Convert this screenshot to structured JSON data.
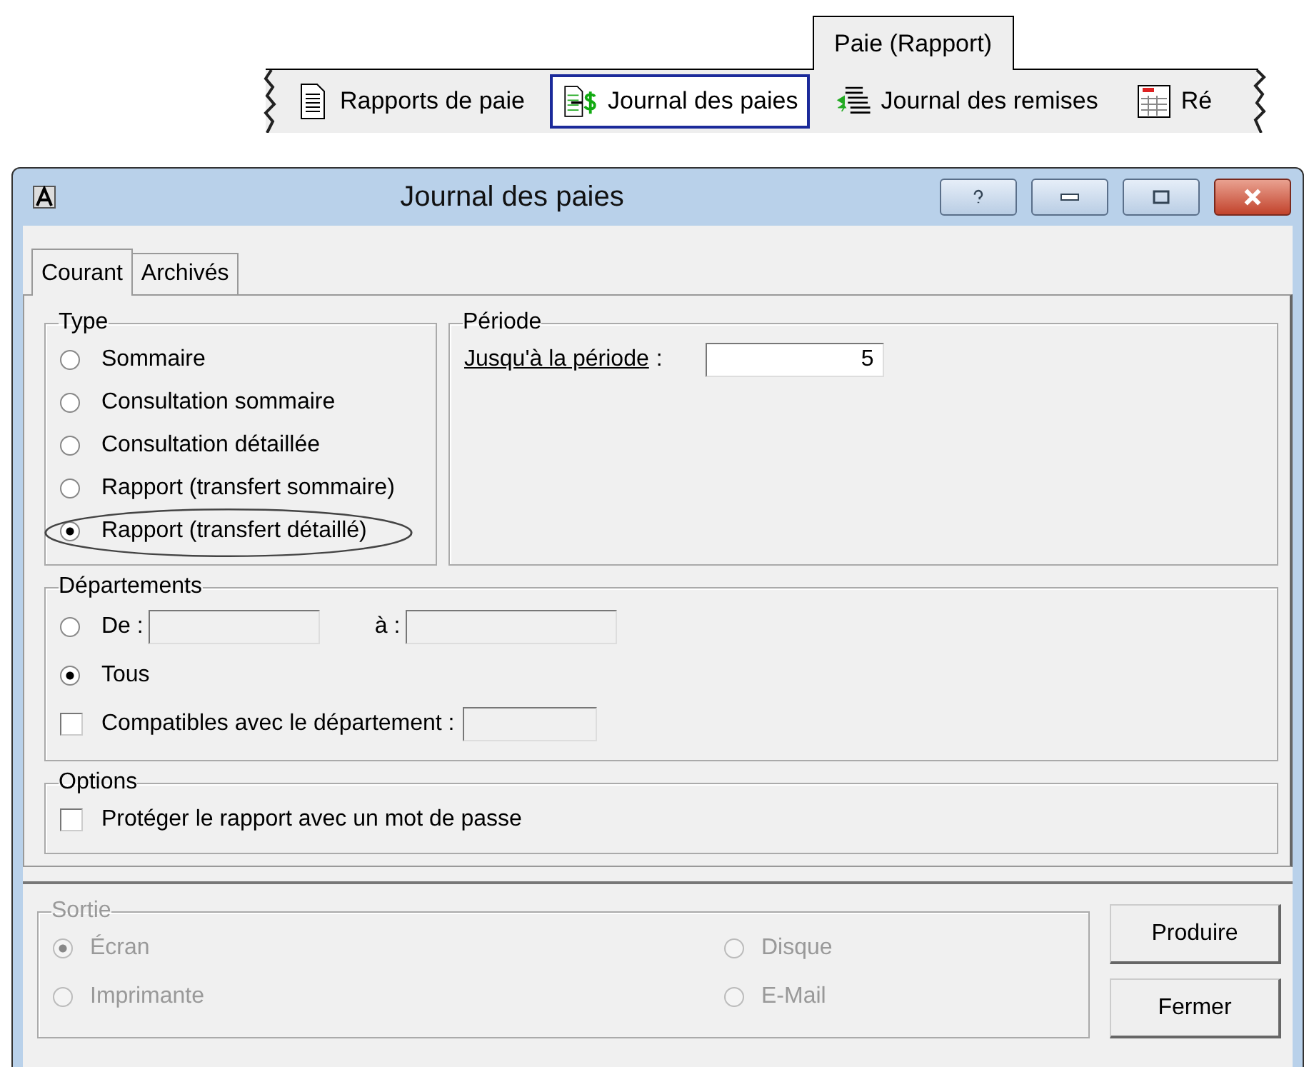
{
  "ribbon": {
    "tab": "Paie (Rapport)",
    "items": [
      {
        "kind": "report",
        "label": "Rapports de paie",
        "selected": false
      },
      {
        "kind": "payroll",
        "label": "Journal des paies",
        "selected": true
      },
      {
        "kind": "remittance",
        "label": "Journal des remises",
        "selected": false
      },
      {
        "kind": "calendar",
        "label": "Ré",
        "selected": false
      }
    ]
  },
  "dialog": {
    "title": "Journal des paies",
    "tabs": [
      {
        "label": "Courant",
        "selected": true
      },
      {
        "label": "Archivés",
        "selected": false
      }
    ],
    "type": {
      "title": "Type",
      "options": [
        {
          "label": "Sommaire",
          "selected": false,
          "highlighted": false
        },
        {
          "label": "Consultation sommaire",
          "selected": false,
          "highlighted": false
        },
        {
          "label": "Consultation détaillée",
          "selected": false,
          "highlighted": false
        },
        {
          "label": "Rapport (transfert sommaire)",
          "selected": false,
          "highlighted": false
        },
        {
          "label": "Rapport (transfert détaillé)",
          "selected": true,
          "highlighted": true
        }
      ]
    },
    "periode": {
      "title": "Période",
      "label": "Jusqu'à la période",
      "colon": ":",
      "value": "5"
    },
    "departements": {
      "title": "Départements",
      "rows": [
        {
          "kind": "range",
          "label": "De :",
          "selected": false,
          "to_label": "à :"
        },
        {
          "kind": "radio",
          "label": "Tous",
          "selected": true
        },
        {
          "kind": "checkbox",
          "label": "Compatibles avec le département :",
          "checked": false
        }
      ]
    },
    "options": {
      "title": "Options",
      "items": [
        {
          "label": "Protéger le rapport avec un mot de passe",
          "checked": false
        }
      ]
    },
    "sortie": {
      "title": "Sortie",
      "disabled": true,
      "options": [
        {
          "label": "Écran",
          "selected": true
        },
        {
          "label": "Disque",
          "selected": false
        },
        {
          "label": "Imprimante",
          "selected": false
        },
        {
          "label": "E-Mail",
          "selected": false
        }
      ]
    },
    "buttons": [
      "Produire",
      "Fermer"
    ]
  }
}
